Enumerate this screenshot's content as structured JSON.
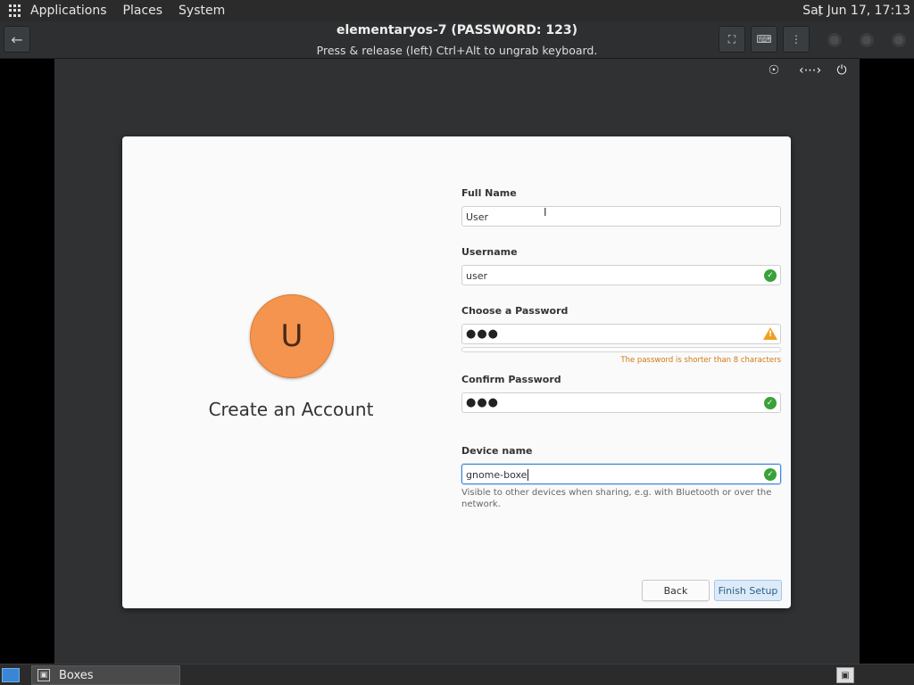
{
  "top_panel": {
    "menus": [
      "Applications",
      "Places",
      "System"
    ],
    "clock": "Sat Jun 17, 17:13"
  },
  "headerbar": {
    "title": "elementaryos-7 (PASSWORD: 123)",
    "subtitle": "Press & release (left) Ctrl+Alt to ungrab keyboard."
  },
  "form": {
    "full_name": {
      "label": "Full Name",
      "value": "User"
    },
    "username": {
      "label": "Username",
      "value": "user"
    },
    "password": {
      "label": "Choose a Password",
      "value": "●●●",
      "warning": "The password is shorter than 8 characters"
    },
    "confirm": {
      "label": "Confirm Password",
      "value": "●●●"
    },
    "device": {
      "label": "Device name",
      "value": "gnome-boxe",
      "hint": "Visible to other devices when sharing, e.g. with Bluetooth or over the network."
    }
  },
  "account": {
    "avatar_letter": "U",
    "title": "Create an Account"
  },
  "buttons": {
    "back": "Back",
    "finish": "Finish Setup"
  },
  "taskbar": {
    "items": [
      "Boxes"
    ]
  },
  "colors": {
    "avatar": "#f4944e",
    "valid": "#3aa13a",
    "warning": "#f0a020",
    "focus": "#3c88d9"
  },
  "icons": [
    "apps-grid-icon",
    "back-arrow-icon",
    "fullscreen-icon",
    "keyboard-icon",
    "menu-dots-icon",
    "accessibility-icon",
    "network-icon",
    "power-icon",
    "valid-check-icon",
    "warning-icon"
  ]
}
